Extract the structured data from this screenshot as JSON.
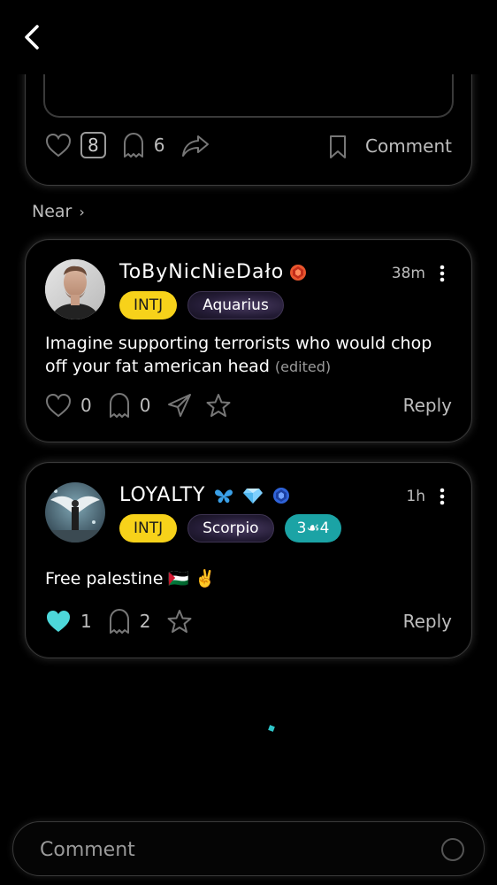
{
  "top_post": {
    "like_count": "8",
    "ghost_count": "6",
    "comment_label": "Comment"
  },
  "near": {
    "label": "Near",
    "chevron": "›"
  },
  "comments": [
    {
      "username": "ToByNicNieDało",
      "badges": [
        "ruby-badge-icon"
      ],
      "time": "38m",
      "mbti": "INTJ",
      "zodiac": "Aquarius",
      "text": "Imagine supporting terrorists who would chop off your fat american head",
      "edited": "(edited)",
      "likes": "0",
      "ghosts": "0",
      "reply_label": "Reply"
    },
    {
      "username": "LOYALTY",
      "badges": [
        "butterfly-icon",
        "diamond-icon",
        "sapphire-badge-icon"
      ],
      "time": "1h",
      "mbti": "INTJ",
      "zodiac": "Scorpio",
      "extra_tag": "3☙4",
      "text": "Free palestine 🇵🇸 ✌️",
      "likes": "1",
      "ghosts": "2",
      "reply_label": "Reply",
      "liked": true
    }
  ],
  "comment_bar": {
    "placeholder": "Comment"
  },
  "colors": {
    "accent": "#1ba3a5",
    "mbti": "#f7d21a",
    "liked_heart": "#4dd8da"
  }
}
